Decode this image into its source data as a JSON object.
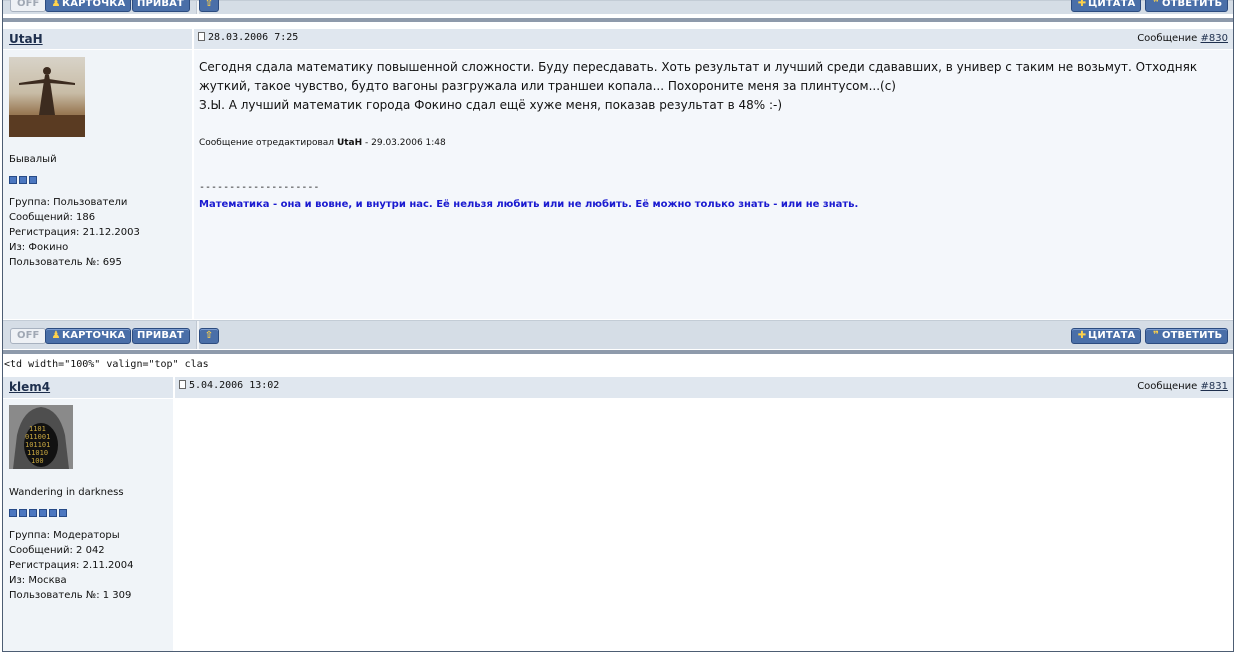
{
  "buttons": {
    "off": "OFF",
    "card": "КАРТОЧКА",
    "private": "ПРИВАТ",
    "quote": "ЦИТАТА",
    "reply": "ОТВЕТИТЬ"
  },
  "broken_html": "<td width=\"100%\" valign=\"top\" clas",
  "posts": [
    {
      "author": "UtaH",
      "date": "28.03.2006 7:25",
      "msg_label": "Сообщение",
      "msg_number": "#830",
      "rank": "Бывалый",
      "pips": 3,
      "group": "Группа: Пользователи",
      "messages": "Сообщений: 186",
      "registered": "Регистрация: 21.12.2003",
      "from": "Из: Фокино",
      "user_no": "Пользователь №: 695",
      "text_line1": "Сегодня сдала математику повышенной сложности. Буду пересдавать. Хоть результат и лучший среди сдававших, в универ с таким не возьмут. Отходняк",
      "text_line2": "жуткий, такое чувство, будто вагоны разгружала или траншеи копала... Похороните меня за плинтусом...(c)",
      "text_line3": "З.Ы. А лучший математик города Фокино сдал ещё хуже меня, показав результат в 48% :-)",
      "edit_prefix": "Сообщение отредактировал",
      "edit_author": "UtaH",
      "edit_suffix": "- 29.03.2006 1:48",
      "sig_separator": "--------------------",
      "signature": "Математика - она и вовне, и внутри нас. Её нельзя любить или не любить. Её можно только знать - или не знать."
    },
    {
      "author": "klem4",
      "date": "5.04.2006 13:02",
      "msg_label": "Сообщение",
      "msg_number": "#831",
      "rank": "Wandering in darkness",
      "pips": 6,
      "group": "Группа: Модераторы",
      "messages": "Сообщений: 2 042",
      "registered": "Регистрация: 2.11.2004",
      "from": "Из: Москва",
      "user_no": "Пользователь №: 1 309"
    }
  ]
}
